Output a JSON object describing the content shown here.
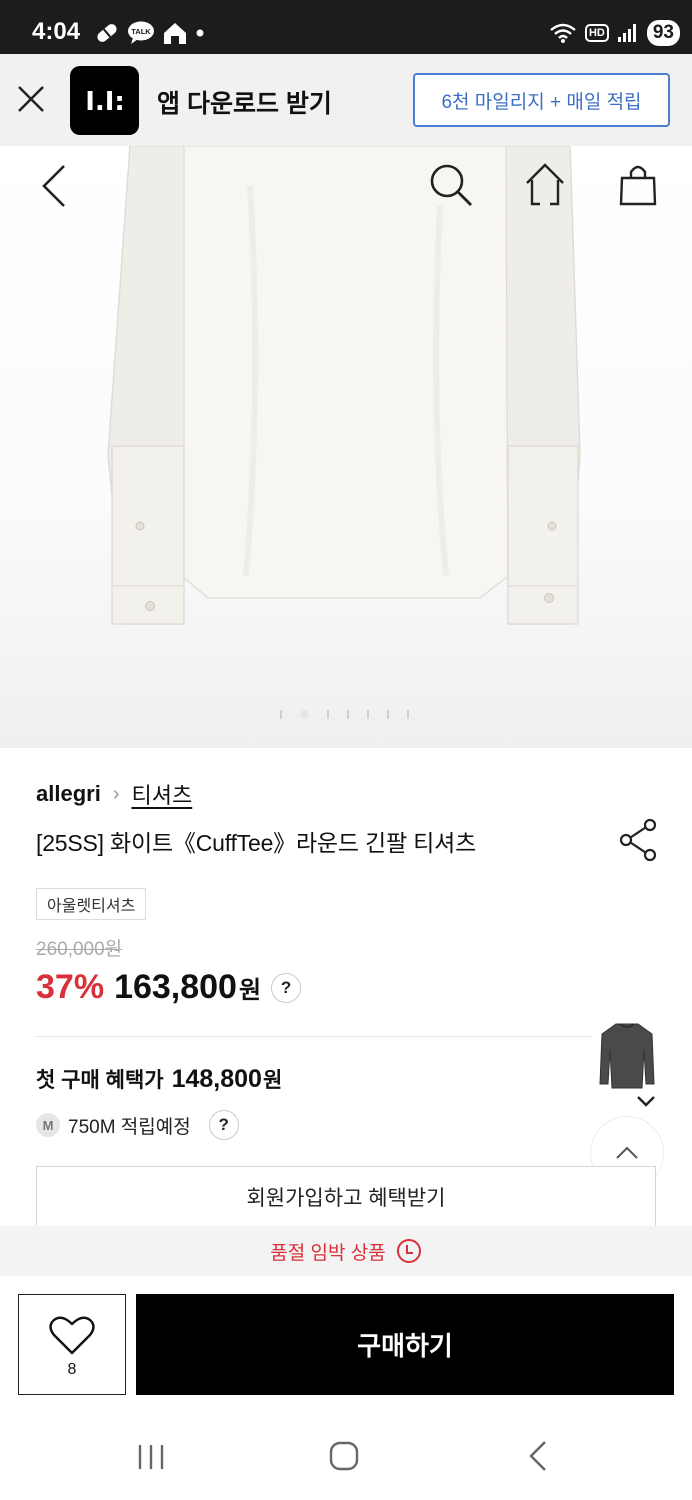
{
  "status_bar": {
    "time": "4:04",
    "battery": "93",
    "network_badge": "HD",
    "talk_badge": "TALK"
  },
  "app_banner": {
    "title": "앱 다운로드 받기",
    "cta": "6천 마일리지 + 매일 적립",
    "logo_text": "I.I:"
  },
  "product": {
    "brand": "allegri",
    "category": "티셔츠",
    "title": "[25SS] 화이트《CuffTee》라운드 긴팔 티셔츠",
    "tag": "아울렛티셔츠",
    "original_price": "260,000원",
    "discount": "37%",
    "price": "163,800",
    "currency": "원",
    "help": "?",
    "first_purchase_label": "첫 구매 혜택가",
    "first_purchase_price": "148,800",
    "mileage_badge": "M",
    "mileage_text": "750M 적립예정",
    "signup_button": "회원가입하고 혜택받기",
    "soldout_notice": "품절 임박 상품"
  },
  "carousel": {
    "total": 7,
    "active_index": 1
  },
  "bottom_bar": {
    "wish_count": "8",
    "buy_label": "구매하기"
  },
  "colors": {
    "accent_red": "#d9303a",
    "banner_blue": "#3b6fc6",
    "buy_black": "#000000"
  },
  "icons": [
    "close-icon",
    "back-icon",
    "search-icon",
    "home-icon",
    "shopping-bag-icon",
    "share-icon",
    "heart-icon",
    "chevron-up-icon",
    "chevron-down-icon",
    "clock-icon"
  ]
}
